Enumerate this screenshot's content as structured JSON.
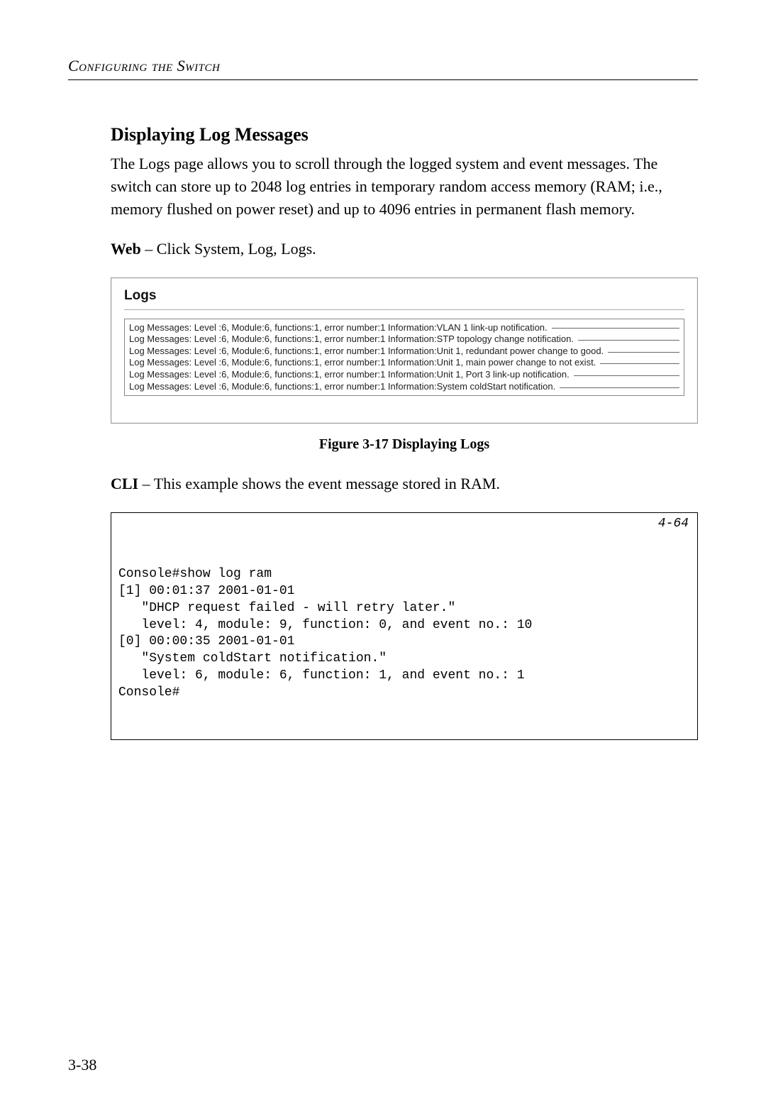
{
  "chapter_header": "Configuring the Switch",
  "section_title": "Displaying Log Messages",
  "intro_para": "The Logs page allows you to scroll through the logged system and event messages. The switch can store up to 2048 log entries in temporary random access memory (RAM; i.e., memory flushed on power reset) and up to 4096 entries in permanent flash memory.",
  "web_label": "Web",
  "web_text": " – Click System, Log, Logs.",
  "web_panel_title": "Logs",
  "log_entries": [
    "Log Messages: Level :6, Module:6, functions:1, error number:1 Information:VLAN 1 link-up notification.",
    "Log Messages: Level :6, Module:6, functions:1, error number:1 Information:STP topology change notification.",
    "Log Messages: Level :6, Module:6, functions:1, error number:1 Information:Unit 1, redundant power change to good.",
    "Log Messages: Level :6, Module:6, functions:1, error number:1 Information:Unit 1, main power change to not exist.",
    "Log Messages: Level :6, Module:6, functions:1, error number:1 Information:Unit 1, Port 3 link-up notification.",
    "Log Messages: Level :6, Module:6, functions:1, error number:1 Information:System coldStart notification."
  ],
  "figure_caption": "Figure 3-17  Displaying Logs",
  "cli_label": "CLI",
  "cli_text": " – This example shows the event message stored in RAM.",
  "cli_ref": "4-64",
  "cli_lines": [
    "Console#show log ram",
    "[1] 00:01:37 2001-01-01",
    "   \"DHCP request failed - will retry later.\"",
    "   level: 4, module: 9, function: 0, and event no.: 10",
    "[0] 00:00:35 2001-01-01",
    "   \"System coldStart notification.\"",
    "   level: 6, module: 6, function: 1, and event no.: 1",
    "Console#"
  ],
  "page_number": "3-38"
}
